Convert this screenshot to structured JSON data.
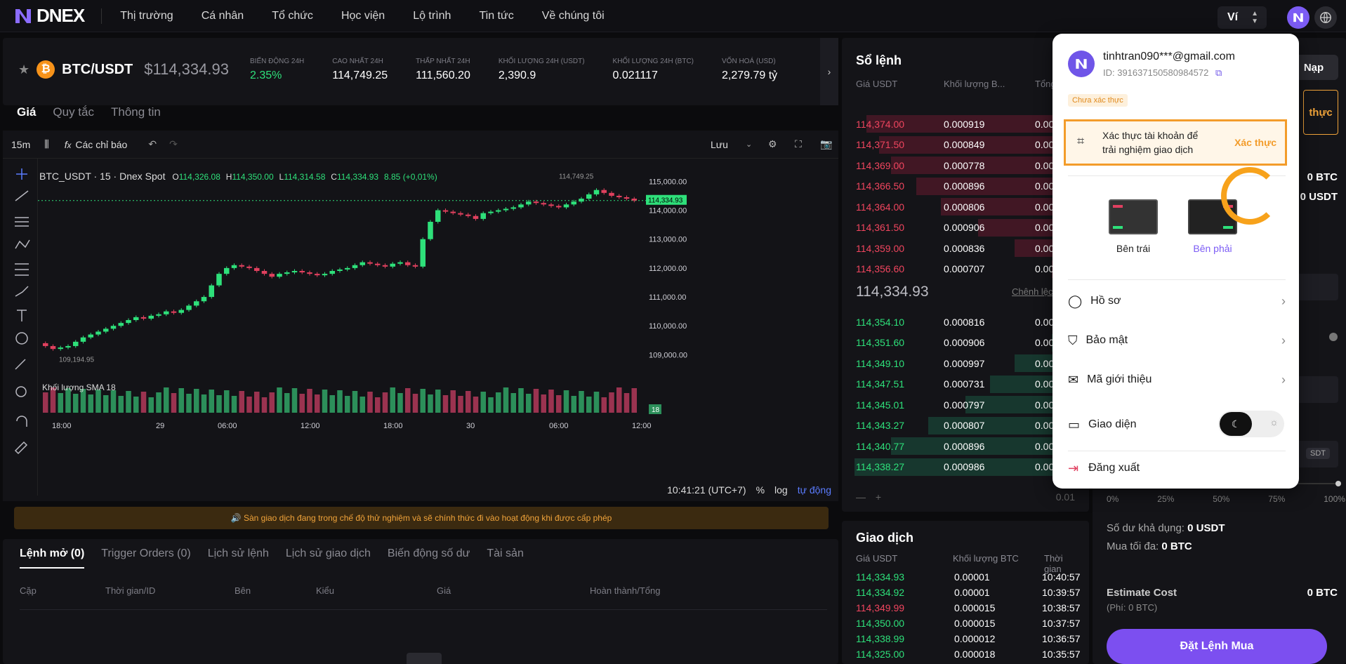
{
  "nav": {
    "brand": "DNEX",
    "links": [
      "Thị trường",
      "Cá nhân",
      "Tổ chức",
      "Học viện",
      "Lộ trình",
      "Tin tức",
      "Về chúng tôi"
    ],
    "wallet_label": "Ví"
  },
  "ticker": {
    "pair": "BTC/USDT",
    "price": "$114,334.93",
    "stats": [
      {
        "label": "BIẾN ĐỘNG 24H",
        "value": "2.35%",
        "color": "#2ee07a"
      },
      {
        "label": "CAO NHẤT 24H",
        "value": "114,749.25",
        "color": "#ffffff"
      },
      {
        "label": "THẤP NHẤT 24H",
        "value": "111,560.20",
        "color": "#ffffff"
      },
      {
        "label": "KHỐI LƯỢNG 24H (USDT)",
        "value": "2,390.9",
        "color": "#ffffff"
      },
      {
        "label": "KHỐI LƯỢNG 24H (BTC)",
        "value": "0.021117",
        "color": "#ffffff"
      },
      {
        "label": "VỐN HOÁ (USD)",
        "value": "2,279.79 tỷ",
        "color": "#ffffff"
      }
    ],
    "tabs": [
      "Giá",
      "Quy tắc",
      "Thông tin"
    ]
  },
  "chart": {
    "interval": "15m",
    "indicators_label": "Các chỉ báo",
    "save_label": "Lưu",
    "symbol_line": "BTC_USDT · 15 · Dnex Spot",
    "ohlc": {
      "o": "114,326.08",
      "h": "114,350.00",
      "l": "114,314.58",
      "c": "114,334.93",
      "chg": "8.85 (+0,01%)"
    },
    "high_label": "114,749.25",
    "low_label": "109,194.95",
    "last_price_tag": "114,334.93",
    "volume_label": "Khối lượng SMA",
    "volume_value": "18",
    "time_labels": [
      "18:00",
      "29",
      "06:00",
      "12:00",
      "18:00",
      "30",
      "06:00",
      "12:00"
    ],
    "price_labels": [
      "115,000.00",
      "114,000.00",
      "113,000.00",
      "112,000.00",
      "111,000.00",
      "110,000.00",
      "109,000.00"
    ],
    "clock": "10:41:21 (UTC+7)",
    "pct": "%",
    "log": "log",
    "auto": "tự động"
  },
  "banner": "🔊 Sàn giao dịch đang trong chế độ thử nghiệm và sẽ chính thức đi vào hoạt động khi được cấp phép",
  "orders": {
    "tabs": [
      "Lệnh mở (0)",
      "Trigger Orders (0)",
      "Lịch sử lệnh",
      "Lịch sử giao dịch",
      "Biến động số dư",
      "Tài sản"
    ],
    "columns": [
      "Cặp",
      "Thời gian/ID",
      "Bên",
      "Kiểu",
      "Giá",
      "Hoàn thành/Tổng"
    ]
  },
  "orderbook": {
    "title": "Sổ lệnh",
    "head_price": "Giá USDT",
    "head_qty": "Khối lượng B...",
    "head_total": "Tổng",
    "asks": [
      {
        "p": "114,374.00",
        "q": "0.000919",
        "t": "0.00",
        "w": 0.9
      },
      {
        "p": "114,371.50",
        "q": "0.000849",
        "t": "0.00",
        "w": 0.85
      },
      {
        "p": "114,369.00",
        "q": "0.000778",
        "t": "0.00",
        "w": 0.8
      },
      {
        "p": "114,366.50",
        "q": "0.000896",
        "t": "0.00",
        "w": 0.7
      },
      {
        "p": "114,364.00",
        "q": "0.000806",
        "t": "0.00",
        "w": 0.6
      },
      {
        "p": "114,361.50",
        "q": "0.000906",
        "t": "0.00",
        "w": 0.45
      },
      {
        "p": "114,359.00",
        "q": "0.000836",
        "t": "0.00",
        "w": 0.3
      },
      {
        "p": "114,356.60",
        "q": "0.000707",
        "t": "0.00",
        "w": 0.15
      }
    ],
    "mid": "114,334.93",
    "mid_link": "Chênh lệc",
    "bids": [
      {
        "p": "114,354.10",
        "q": "0.000816",
        "t": "0.00",
        "w": 0.08
      },
      {
        "p": "114,351.60",
        "q": "0.000906",
        "t": "0.00",
        "w": 0.15
      },
      {
        "p": "114,349.10",
        "q": "0.000997",
        "t": "0.00",
        "w": 0.3
      },
      {
        "p": "114,347.51",
        "q": "0.000731",
        "t": "0.00",
        "w": 0.4
      },
      {
        "p": "114,345.01",
        "q": "0.000797",
        "t": "0.00",
        "w": 0.5
      },
      {
        "p": "114,343.27",
        "q": "0.000807",
        "t": "0.00",
        "w": 0.65
      },
      {
        "p": "114,340.77",
        "q": "0.000896",
        "t": "0.00",
        "w": 0.8
      },
      {
        "p": "114,338.27",
        "q": "0.000986",
        "t": "0.00",
        "w": 0.95
      }
    ],
    "step": "0.01"
  },
  "trades": {
    "title": "Giao dịch",
    "head": [
      "Giá USDT",
      "Khối lượng BTC",
      "Thời gian"
    ],
    "rows": [
      {
        "p": "114,334.93",
        "q": "0.00001",
        "t": "10:40:57",
        "side": "buy"
      },
      {
        "p": "114,334.92",
        "q": "0.00001",
        "t": "10:39:57",
        "side": "buy"
      },
      {
        "p": "114,349.99",
        "q": "0.000015",
        "t": "10:38:57",
        "side": "sell"
      },
      {
        "p": "114,350.00",
        "q": "0.000015",
        "t": "10:37:57",
        "side": "buy"
      },
      {
        "p": "114,338.99",
        "q": "0.000012",
        "t": "10:36:57",
        "side": "buy"
      },
      {
        "p": "114,325.00",
        "q": "0.000018",
        "t": "10:35:57",
        "side": "buy"
      }
    ]
  },
  "buy": {
    "nap": "Nạp",
    "verify_short": "thực",
    "btc_bal": "0 BTC",
    "usdt_bal": "0 USDT",
    "slider_marks": [
      "0%",
      "25%",
      "50%",
      "75%",
      "100%"
    ],
    "usdt_unit": "SDT",
    "avail_label": "Số dư khả dụng:",
    "avail_value": "0 USDT",
    "max_label": "Mua tối đa:",
    "max_value": "0 BTC",
    "est_label": "Estimate Cost",
    "est_value": "0 BTC",
    "fee": "(Phí: 0 BTC)",
    "submit": "Đặt Lệnh Mua"
  },
  "profile": {
    "email": "tinhtran090***@gmail.com",
    "id": "ID: 391637150580984572",
    "status_badge": "Chưa xác thực",
    "verify_text_1": "Xác thực tài khoản để",
    "verify_text_2": "trải nghiệm giao dịch",
    "verify_btn": "Xác thực",
    "layout_left": "Bên trái",
    "layout_right": "Bên phải",
    "menu": [
      "Hồ sơ",
      "Bảo mật",
      "Mã giới thiệu"
    ],
    "theme_label": "Giao diện",
    "logout": "Đăng xuất",
    "accent": "#7c5cf5"
  }
}
